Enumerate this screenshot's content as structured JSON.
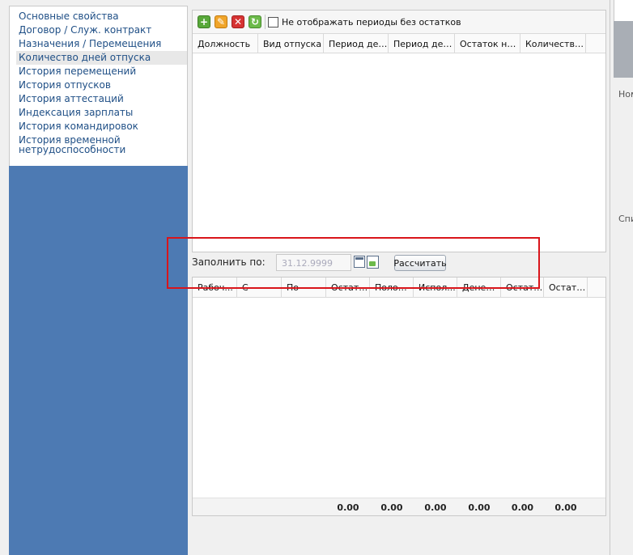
{
  "nav": {
    "items": [
      {
        "label": "Основные свойства"
      },
      {
        "label": "Договор / Служ. контракт"
      },
      {
        "label": "Назначения / Перемещения"
      },
      {
        "label": "Количество дней отпуска",
        "selected": true
      },
      {
        "label": "История перемещений"
      },
      {
        "label": "История отпусков"
      },
      {
        "label": "История аттестаций"
      },
      {
        "label": "Индексация зарплаты"
      },
      {
        "label": "История командировок"
      },
      {
        "label": "История временной нетрудоспособности"
      }
    ]
  },
  "toolbar": {
    "add_icon": "plus-icon",
    "edit_icon": "pencil-icon",
    "delete_icon": "x-icon",
    "refresh_icon": "refresh-icon",
    "hide_empty_label": "Не отображать периоды без остатков",
    "hide_empty_checked": false
  },
  "grid1": {
    "columns": [
      "Должность",
      "Вид отпуска",
      "Период дей...",
      "Период дей...",
      "Остаток на ...",
      "Количество..."
    ]
  },
  "fill": {
    "label": "Заполнить по:",
    "date_placeholder": "31.12.9999",
    "calculate_label": "Рассчитать"
  },
  "grid2": {
    "columns": [
      "Рабоч...",
      "С",
      "По",
      "Остато...",
      "Полож...",
      "Испол...",
      "Денеж...",
      "Остато...",
      "Остато..."
    ],
    "totals": [
      "",
      "",
      "",
      "0.00",
      "0.00",
      "0.00",
      "0.00",
      "0.00",
      "0.00"
    ]
  },
  "right_strip": {
    "label1": "Ном",
    "label2": "Спи"
  },
  "colors": {
    "nav_panel": "#4d7ab3",
    "link": "#1f4f86",
    "highlight": "#d9151b"
  }
}
